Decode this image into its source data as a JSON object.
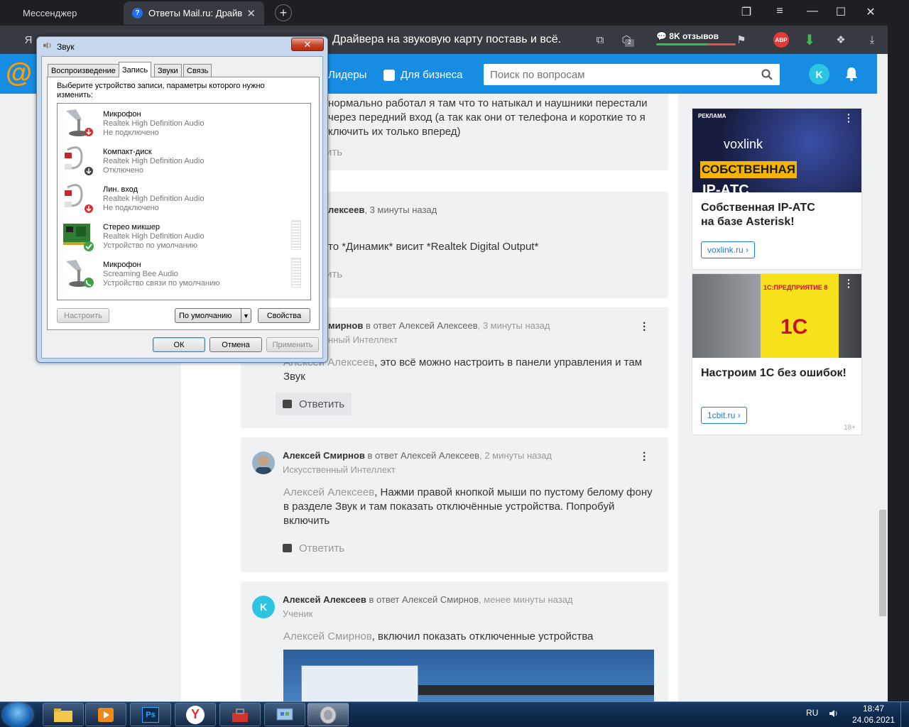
{
  "browser": {
    "tabs": [
      {
        "label": "Мессенджер"
      },
      {
        "label": "Ответы Mail.ru: Драйве"
      }
    ],
    "page_title": "Драйвера на звуковую карту поставь и всё.",
    "reviews": "8K отзывов",
    "badge_count": "2",
    "abp_label": "ABP"
  },
  "header": {
    "leaders": "Лидеры",
    "business": "Для бизнеса",
    "search_placeholder": "Поиск по вопросам",
    "avatar_letter": "K"
  },
  "answers": [
    {
      "text": "нормально работал я там что то натыкал и наушники перестали через передний вход (а так как они от телефона и короткие то я ключить их только вперед)",
      "lines": [
        "нормально работал я там что то натыкал и наушники перестали",
        "через передний вход (а так как они от телефона и короткие то я",
        "ключить их только вперед)"
      ],
      "reply": "ить"
    },
    {
      "author_tail": "лексеев",
      "time": ", 3 минуты назад",
      "text": "то *Динамик* висит *Realtek Digital Output*",
      "reply": "ить"
    },
    {
      "author_tail": "мирнов",
      "reply_to": " в ответ Алексей Алексеев",
      "time": ", 3 минуты назад",
      "role_tail": "нный Интеллект",
      "mention": "Алексей Алексеев",
      "text_lines": [
        ", это всё можно настроить в панели управления и там",
        "Звук"
      ],
      "reply": "Ответить"
    },
    {
      "author": "Алексей Смирнов",
      "reply_to": " в ответ Алексей Алексеев",
      "time": ", 2 минуты назад",
      "role": "Искусственный Интеллект",
      "mention": "Алексей Алексеев",
      "text_lines": [
        ", Нажми правой кнопкой мыши по пустому белому фону",
        "в разделе Звук и там показать отключённые устройства. Попробуй",
        "включить"
      ],
      "reply": "Ответить"
    },
    {
      "author": "Алексей Алексеев",
      "reply_to": " в ответ Алексей Смирнов",
      "time": ", менее минуты назад",
      "role": "Ученик",
      "avatar_letter": "K",
      "mention": "Алексей Смирнов",
      "text": ", включил показать отключенные устройства"
    }
  ],
  "ads": [
    {
      "label": "РЕКЛАМА",
      "brand": "voxlink",
      "banner": "СОБСТВЕННАЯ",
      "banner2": "IP-АТС",
      "title_lines": [
        "Собственная IP-АТС",
        "на базе Asterisk!"
      ],
      "link": "voxlink.ru"
    },
    {
      "banner": "1С:ПРЕДПРИЯТИЕ 8",
      "logo": "1С",
      "title": "Настроим 1С без ошибок!",
      "link": "1cbit.ru",
      "age": "18+"
    }
  ],
  "dialog": {
    "title": "Звук",
    "tabs": [
      "Воспроизведение",
      "Запись",
      "Звуки",
      "Связь"
    ],
    "prompt": "Выберите устройство записи, параметры которого нужно изменить:",
    "devices": [
      {
        "name": "Микрофон",
        "driver": "Realtek High Definition Audio",
        "status": "Не подключено"
      },
      {
        "name": "Компакт-диск",
        "driver": "Realtek High Definition Audio",
        "status": "Отключено"
      },
      {
        "name": "Лин. вход",
        "driver": "Realtek High Definition Audio",
        "status": "Не подключено"
      },
      {
        "name": "Стерео микшер",
        "driver": "Realtek High Definition Audio",
        "status": "Устройство по умолчанию"
      },
      {
        "name": "Микрофон",
        "driver": "Screaming Bee Audio",
        "status": "Устройство связи по умолчанию"
      }
    ],
    "buttons": {
      "configure": "Настроить",
      "default": "По умолчанию",
      "properties": "Свойства",
      "ok": "ОК",
      "cancel": "Отмена",
      "apply": "Применить"
    }
  },
  "taskbar": {
    "lang": "RU",
    "time": "18:47",
    "date": "24.06.2021"
  }
}
